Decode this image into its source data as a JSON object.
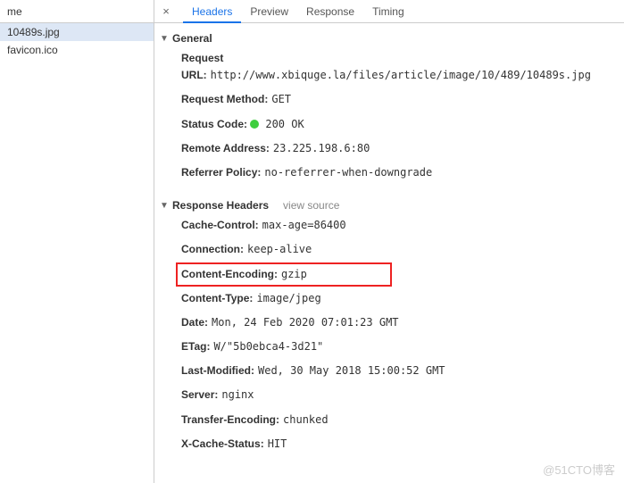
{
  "sidebar": {
    "header": "me",
    "files": [
      {
        "name": "10489s.jpg",
        "selected": true
      },
      {
        "name": "favicon.ico",
        "selected": false
      }
    ]
  },
  "tabs": {
    "close": "×",
    "items": [
      {
        "label": "Headers",
        "active": true
      },
      {
        "label": "Preview",
        "active": false
      },
      {
        "label": "Response",
        "active": false
      },
      {
        "label": "Timing",
        "active": false
      }
    ]
  },
  "general": {
    "title": "General",
    "rows": [
      {
        "key": "Request URL:",
        "value": "http://www.xbiquge.la/files/article/image/10/489/10489s.jpg"
      },
      {
        "key": "Request Method:",
        "value": "GET"
      },
      {
        "key": "Status Code:",
        "value": "200 OK",
        "status": true
      },
      {
        "key": "Remote Address:",
        "value": "23.225.198.6:80"
      },
      {
        "key": "Referrer Policy:",
        "value": "no-referrer-when-downgrade"
      }
    ]
  },
  "responseHeaders": {
    "title": "Response Headers",
    "viewSource": "view source",
    "rows": [
      {
        "key": "Cache-Control:",
        "value": "max-age=86400"
      },
      {
        "key": "Connection:",
        "value": "keep-alive"
      },
      {
        "key": "Content-Encoding:",
        "value": "gzip",
        "highlight": true
      },
      {
        "key": "Content-Type:",
        "value": "image/jpeg"
      },
      {
        "key": "Date:",
        "value": "Mon, 24 Feb 2020 07:01:23 GMT"
      },
      {
        "key": "ETag:",
        "value": "W/\"5b0ebca4-3d21\""
      },
      {
        "key": "Last-Modified:",
        "value": "Wed, 30 May 2018 15:00:52 GMT"
      },
      {
        "key": "Server:",
        "value": "nginx"
      },
      {
        "key": "Transfer-Encoding:",
        "value": "chunked"
      },
      {
        "key": "X-Cache-Status:",
        "value": "HIT"
      }
    ]
  },
  "watermark": "@51CTO博客"
}
